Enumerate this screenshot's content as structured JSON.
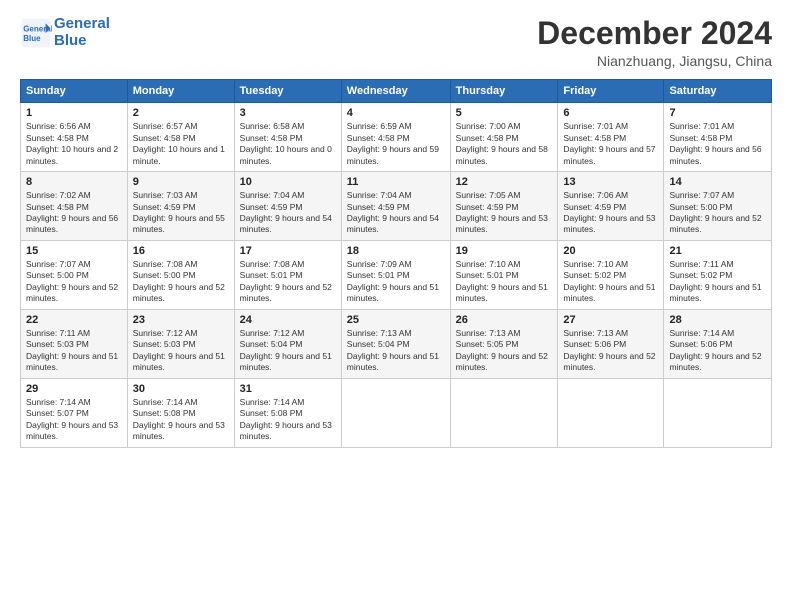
{
  "header": {
    "logo_line1": "General",
    "logo_line2": "Blue",
    "month_title": "December 2024",
    "location": "Nianzhuang, Jiangsu, China"
  },
  "days_of_week": [
    "Sunday",
    "Monday",
    "Tuesday",
    "Wednesday",
    "Thursday",
    "Friday",
    "Saturday"
  ],
  "weeks": [
    [
      {
        "day": "1",
        "sunrise": "6:56 AM",
        "sunset": "4:58 PM",
        "daylight": "10 hours and 2 minutes."
      },
      {
        "day": "2",
        "sunrise": "6:57 AM",
        "sunset": "4:58 PM",
        "daylight": "10 hours and 1 minute."
      },
      {
        "day": "3",
        "sunrise": "6:58 AM",
        "sunset": "4:58 PM",
        "daylight": "10 hours and 0 minutes."
      },
      {
        "day": "4",
        "sunrise": "6:59 AM",
        "sunset": "4:58 PM",
        "daylight": "9 hours and 59 minutes."
      },
      {
        "day": "5",
        "sunrise": "7:00 AM",
        "sunset": "4:58 PM",
        "daylight": "9 hours and 58 minutes."
      },
      {
        "day": "6",
        "sunrise": "7:01 AM",
        "sunset": "4:58 PM",
        "daylight": "9 hours and 57 minutes."
      },
      {
        "day": "7",
        "sunrise": "7:01 AM",
        "sunset": "4:58 PM",
        "daylight": "9 hours and 56 minutes."
      }
    ],
    [
      {
        "day": "8",
        "sunrise": "7:02 AM",
        "sunset": "4:58 PM",
        "daylight": "9 hours and 56 minutes."
      },
      {
        "day": "9",
        "sunrise": "7:03 AM",
        "sunset": "4:59 PM",
        "daylight": "9 hours and 55 minutes."
      },
      {
        "day": "10",
        "sunrise": "7:04 AM",
        "sunset": "4:59 PM",
        "daylight": "9 hours and 54 minutes."
      },
      {
        "day": "11",
        "sunrise": "7:04 AM",
        "sunset": "4:59 PM",
        "daylight": "9 hours and 54 minutes."
      },
      {
        "day": "12",
        "sunrise": "7:05 AM",
        "sunset": "4:59 PM",
        "daylight": "9 hours and 53 minutes."
      },
      {
        "day": "13",
        "sunrise": "7:06 AM",
        "sunset": "4:59 PM",
        "daylight": "9 hours and 53 minutes."
      },
      {
        "day": "14",
        "sunrise": "7:07 AM",
        "sunset": "5:00 PM",
        "daylight": "9 hours and 52 minutes."
      }
    ],
    [
      {
        "day": "15",
        "sunrise": "7:07 AM",
        "sunset": "5:00 PM",
        "daylight": "9 hours and 52 minutes."
      },
      {
        "day": "16",
        "sunrise": "7:08 AM",
        "sunset": "5:00 PM",
        "daylight": "9 hours and 52 minutes."
      },
      {
        "day": "17",
        "sunrise": "7:08 AM",
        "sunset": "5:01 PM",
        "daylight": "9 hours and 52 minutes."
      },
      {
        "day": "18",
        "sunrise": "7:09 AM",
        "sunset": "5:01 PM",
        "daylight": "9 hours and 51 minutes."
      },
      {
        "day": "19",
        "sunrise": "7:10 AM",
        "sunset": "5:01 PM",
        "daylight": "9 hours and 51 minutes."
      },
      {
        "day": "20",
        "sunrise": "7:10 AM",
        "sunset": "5:02 PM",
        "daylight": "9 hours and 51 minutes."
      },
      {
        "day": "21",
        "sunrise": "7:11 AM",
        "sunset": "5:02 PM",
        "daylight": "9 hours and 51 minutes."
      }
    ],
    [
      {
        "day": "22",
        "sunrise": "7:11 AM",
        "sunset": "5:03 PM",
        "daylight": "9 hours and 51 minutes."
      },
      {
        "day": "23",
        "sunrise": "7:12 AM",
        "sunset": "5:03 PM",
        "daylight": "9 hours and 51 minutes."
      },
      {
        "day": "24",
        "sunrise": "7:12 AM",
        "sunset": "5:04 PM",
        "daylight": "9 hours and 51 minutes."
      },
      {
        "day": "25",
        "sunrise": "7:13 AM",
        "sunset": "5:04 PM",
        "daylight": "9 hours and 51 minutes."
      },
      {
        "day": "26",
        "sunrise": "7:13 AM",
        "sunset": "5:05 PM",
        "daylight": "9 hours and 52 minutes."
      },
      {
        "day": "27",
        "sunrise": "7:13 AM",
        "sunset": "5:06 PM",
        "daylight": "9 hours and 52 minutes."
      },
      {
        "day": "28",
        "sunrise": "7:14 AM",
        "sunset": "5:06 PM",
        "daylight": "9 hours and 52 minutes."
      }
    ],
    [
      {
        "day": "29",
        "sunrise": "7:14 AM",
        "sunset": "5:07 PM",
        "daylight": "9 hours and 53 minutes."
      },
      {
        "day": "30",
        "sunrise": "7:14 AM",
        "sunset": "5:08 PM",
        "daylight": "9 hours and 53 minutes."
      },
      {
        "day": "31",
        "sunrise": "7:14 AM",
        "sunset": "5:08 PM",
        "daylight": "9 hours and 53 minutes."
      },
      null,
      null,
      null,
      null
    ]
  ],
  "labels": {
    "sunrise": "Sunrise:",
    "sunset": "Sunset:",
    "daylight": "Daylight:"
  }
}
